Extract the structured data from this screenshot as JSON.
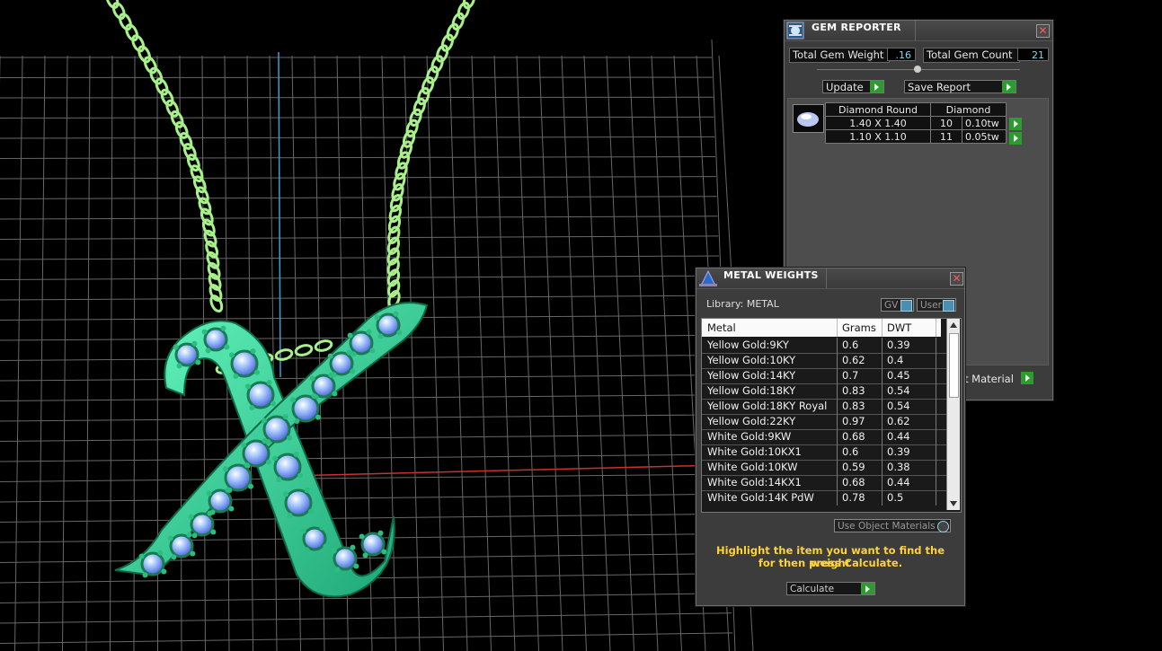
{
  "gem_reporter": {
    "title": "GEM REPORTER",
    "close": "✕",
    "total_gem_weight_label": "Total Gem Weight",
    "total_gem_weight_value": ".16",
    "total_gem_count_label": "Total Gem Count",
    "total_gem_count_value": "21",
    "update_label": "Update",
    "save_report_label": "Save Report",
    "table_headers": [
      "Diamond Round",
      "Diamond"
    ],
    "rows": [
      {
        "size": "1.40 X 1.40",
        "count": "10",
        "weight": "0.10tw"
      },
      {
        "size": "1.10 X 1.10",
        "count": "11",
        "weight": "0.05tw"
      }
    ],
    "material_label": "t Material"
  },
  "metal_weights": {
    "title": "METAL WEIGHTS",
    "close": "✕",
    "library_label": "Library: METAL",
    "gv_label": "GV",
    "user_label": "User",
    "columns": [
      "Metal",
      "Grams",
      "DWT"
    ],
    "rows": [
      {
        "metal": "Yellow Gold:9KY",
        "grams": "0.6",
        "dwt": "0.39"
      },
      {
        "metal": "Yellow Gold:10KY",
        "grams": "0.62",
        "dwt": "0.4"
      },
      {
        "metal": "Yellow Gold:14KY",
        "grams": "0.7",
        "dwt": "0.45"
      },
      {
        "metal": "Yellow Gold:18KY",
        "grams": "0.83",
        "dwt": "0.54"
      },
      {
        "metal": "Yellow Gold:18KY Royal",
        "grams": "0.83",
        "dwt": "0.54"
      },
      {
        "metal": "Yellow Gold:22KY",
        "grams": "0.97",
        "dwt": "0.62"
      },
      {
        "metal": "White Gold:9KW",
        "grams": "0.68",
        "dwt": "0.44"
      },
      {
        "metal": "White Gold:10KX1",
        "grams": "0.6",
        "dwt": "0.39"
      },
      {
        "metal": "White Gold:10KW",
        "grams": "0.59",
        "dwt": "0.38"
      },
      {
        "metal": "White Gold:14KX1",
        "grams": "0.68",
        "dwt": "0.44"
      },
      {
        "metal": "White Gold:14K PdW",
        "grams": "0.78",
        "dwt": "0.5"
      }
    ],
    "use_object_materials_label": "Use Object Materials",
    "hint_line1": "Highlight the item you want to find the weight",
    "hint_line2": "for then press Calculate.",
    "calculate_label": "Calculate"
  },
  "colors": {
    "gem_blue": "#8fb8ff",
    "metal_green": "#3fd8a0",
    "chain_green": "#a8f08a",
    "grid": "#8a8a8a",
    "axis_red": "#c83232",
    "axis_blue": "#3aa0d0",
    "accent_green": "#2e9b2e",
    "hint_yellow": "#ffd23a"
  }
}
